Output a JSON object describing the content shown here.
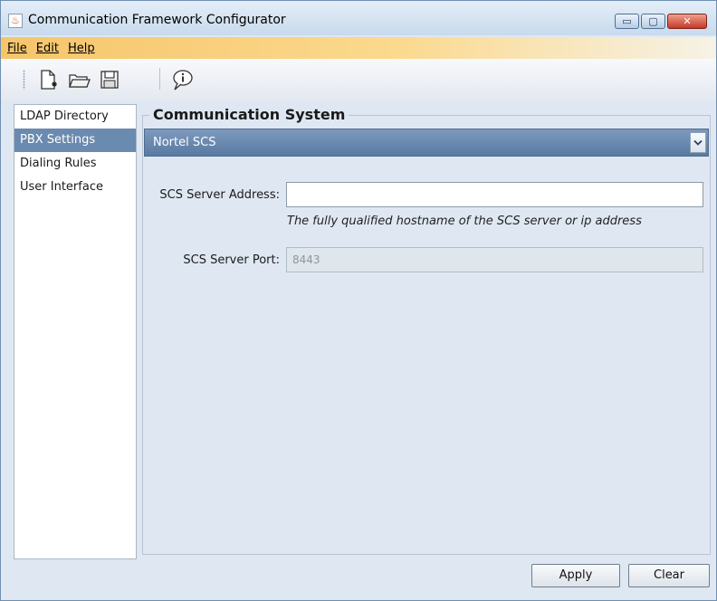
{
  "window": {
    "title": "Communication Framework Configurator",
    "controls": {
      "minimize": "▭",
      "maximize": "▢",
      "close": "✕"
    }
  },
  "menu": {
    "items": [
      "File",
      "Edit",
      "Help"
    ]
  },
  "toolbar": {
    "buttons": [
      "new-document-icon",
      "open-folder-icon",
      "save-disk-icon",
      "info-bubble-icon"
    ]
  },
  "sidebar": {
    "items": [
      {
        "label": "LDAP Directory"
      },
      {
        "label": "PBX Settings",
        "selected": true
      },
      {
        "label": "Dialing Rules"
      },
      {
        "label": "User Interface"
      }
    ]
  },
  "panel": {
    "title": "Communication System",
    "system_select": {
      "value": "Nortel SCS"
    },
    "server_address": {
      "label": "SCS Server Address:",
      "value": "",
      "hint": "The fully qualified hostname of the SCS server or ip address"
    },
    "server_port": {
      "label": "SCS Server Port:",
      "value": "8443",
      "disabled": true
    }
  },
  "actions": {
    "apply_label": "Apply",
    "clear_label": "Clear"
  },
  "colors": {
    "accent": "#6b8aaf",
    "menubar": "#f6c56b",
    "background": "#dfe8f2"
  }
}
